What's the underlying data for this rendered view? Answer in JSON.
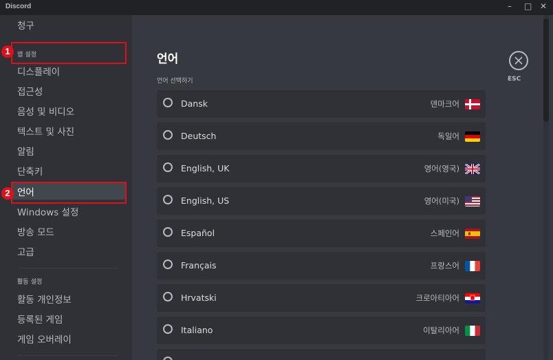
{
  "window": {
    "app_name": "Discord",
    "controls": {
      "minimize": "–",
      "maximize": "□",
      "close": "✕"
    }
  },
  "sidebar": {
    "top_item": "청구",
    "app_settings_header": "앱 설정",
    "app_items": [
      "디스플레이",
      "접근성",
      "음성 및 비디오",
      "텍스트 및 사진",
      "알림",
      "단축키",
      "언어",
      "Windows 설정",
      "방송 모드",
      "고급"
    ],
    "selected_item": "언어",
    "activity_header": "활동 설정",
    "activity_items": [
      "활동 개인정보",
      "등록된 게임",
      "게임 오버레이"
    ]
  },
  "annotations": [
    "1",
    "2"
  ],
  "annotation_color": "#e0101a",
  "main": {
    "title": "언어",
    "section_label": "언어 선택하기",
    "esc_label": "ESC",
    "languages": [
      {
        "name": "Dansk",
        "local": "덴마크어",
        "flag": "dk-flag-icon"
      },
      {
        "name": "Deutsch",
        "local": "독일어",
        "flag": "de-flag-icon"
      },
      {
        "name": "English, UK",
        "local": "영어(영국)",
        "flag": "gb-flag-icon"
      },
      {
        "name": "English, US",
        "local": "영어(미국)",
        "flag": "us-flag-icon"
      },
      {
        "name": "Español",
        "local": "스페인어",
        "flag": "es-flag-icon"
      },
      {
        "name": "Français",
        "local": "프랑스어",
        "flag": "fr-flag-icon"
      },
      {
        "name": "Hrvatski",
        "local": "크로아티아어",
        "flag": "hr-flag-icon"
      },
      {
        "name": "Italiano",
        "local": "이탈리아어",
        "flag": "it-flag-icon"
      }
    ]
  },
  "colors": {
    "sidebar_bg": "#2f3136",
    "content_bg": "#36393f",
    "titlebar_bg": "#202225",
    "row_bg": "#2f3136",
    "selected_bg": "#42464d"
  }
}
